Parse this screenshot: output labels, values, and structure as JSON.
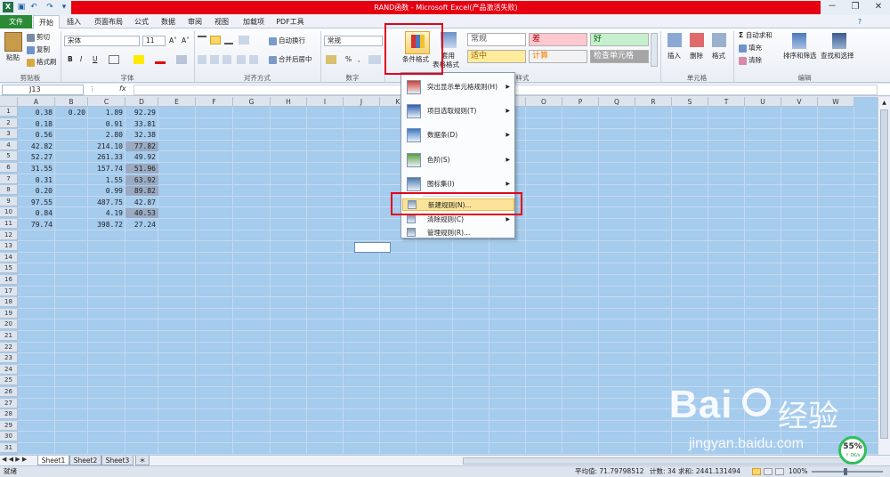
{
  "window": {
    "title": "RAND函数 - Microsoft Excel(产品激活失败)",
    "minimize": "－",
    "restore": "❐",
    "close": "✕"
  },
  "qat": {
    "save_glyph": "▣",
    "undo_glyph": "↶",
    "redo_glyph": "↷",
    "more_glyph": "▾"
  },
  "tabs": [
    "文件",
    "开始",
    "插入",
    "页面布局",
    "公式",
    "数据",
    "审阅",
    "视图",
    "加载项",
    "PDF工具"
  ],
  "ribbon": {
    "clipboard": {
      "paste": "粘贴",
      "cut": "剪切",
      "copy": "复制",
      "format_painter": "格式刷",
      "label": "剪贴板"
    },
    "font": {
      "font_name": "宋体",
      "font_size": "11",
      "grow": "A˄",
      "shrink": "A˅",
      "bold": "B",
      "italic": "I",
      "underline": "U",
      "label": "字体"
    },
    "alignment": {
      "wrap": "自动换行",
      "merge": "合并后居中",
      "label": "对齐方式"
    },
    "number": {
      "format": "常规",
      "percent": "%",
      "comma": ",",
      "label": "数字"
    },
    "styles": {
      "conditional": "条件格式",
      "table_format_line1": "套用",
      "table_format_line2": "表格格式",
      "cells": [
        {
          "text": "常规",
          "bg": "#ffffff",
          "color": "#555555"
        },
        {
          "text": "差",
          "bg": "#ffc7ce",
          "color": "#9c0006"
        },
        {
          "text": "好",
          "bg": "#c6efce",
          "color": "#006100"
        },
        {
          "text": "适中",
          "bg": "#ffeb9c",
          "color": "#9c6500"
        },
        {
          "text": "计算",
          "bg": "#f2f2f2",
          "color": "#fa7d00"
        },
        {
          "text": "检查单元格",
          "bg": "#a5a5a5",
          "color": "#ffffff"
        }
      ],
      "label": "样式"
    },
    "cells_group": {
      "insert": "插入",
      "delete": "删除",
      "format": "格式",
      "label": "单元格"
    },
    "editing": {
      "autosum": "自动求和",
      "fill": "填充",
      "clear": "清除",
      "sort_filter": "排序和筛选",
      "find_select": "查找和选择",
      "label": "编辑"
    }
  },
  "formula": {
    "name_box": "J13",
    "fx": "fx",
    "value": ""
  },
  "columns": [
    "A",
    "B",
    "C",
    "D",
    "E",
    "F",
    "G",
    "H",
    "I",
    "J",
    "K",
    "L",
    "M",
    "N",
    "O",
    "P",
    "Q",
    "R",
    "S",
    "T",
    "U",
    "V",
    "W"
  ],
  "rows": [
    "1",
    "2",
    "3",
    "4",
    "5",
    "6",
    "7",
    "8",
    "9",
    "10",
    "11",
    "12",
    "13",
    "14",
    "15",
    "16",
    "17",
    "18",
    "19",
    "20",
    "21",
    "22",
    "23",
    "24",
    "25",
    "26",
    "27",
    "28",
    "29",
    "30",
    "31"
  ],
  "data": [
    {
      "A": "0.38",
      "B": "0.20",
      "C": "1.89",
      "D": "92.29",
      "D_hl": false
    },
    {
      "A": "0.18",
      "B": "",
      "C": "0.91",
      "D": "33.81",
      "D_hl": false
    },
    {
      "A": "0.56",
      "B": "",
      "C": "2.80",
      "D": "32.38",
      "D_hl": false
    },
    {
      "A": "42.82",
      "B": "",
      "C": "214.10",
      "D": "77.82",
      "D_hl": true
    },
    {
      "A": "52.27",
      "B": "",
      "C": "261.33",
      "D": "49.92",
      "D_hl": false
    },
    {
      "A": "31.55",
      "B": "",
      "C": "157.74",
      "D": "51.96",
      "D_hl": true
    },
    {
      "A": "0.31",
      "B": "",
      "C": "1.55",
      "D": "63.92",
      "D_hl": true
    },
    {
      "A": "0.20",
      "B": "",
      "C": "0.99",
      "D": "89.82",
      "D_hl": true
    },
    {
      "A": "97.55",
      "B": "",
      "C": "487.75",
      "D": "42.87",
      "D_hl": false
    },
    {
      "A": "0.84",
      "B": "",
      "C": "4.19",
      "D": "40.53",
      "D_hl": true
    },
    {
      "A": "79.74",
      "B": "",
      "C": "398.72",
      "D": "27.24",
      "D_hl": false
    }
  ],
  "menu": [
    {
      "label": "突出显示单元格规则(H)",
      "arrow": "▶",
      "icon_color": "#d04030"
    },
    {
      "label": "项目选取规则(T)",
      "arrow": "▶",
      "icon_color": "#3060b0"
    },
    {
      "label": "数据条(D)",
      "arrow": "▶",
      "icon_color": "#3c78c8"
    },
    {
      "label": "色阶(S)",
      "arrow": "▶",
      "icon_color": "#5aa040"
    },
    {
      "label": "图标集(I)",
      "arrow": "▶",
      "icon_color": "#4a7ab0"
    },
    {
      "label": "新建规则(N)...",
      "arrow": "",
      "icon_color": "#8898b0"
    },
    {
      "label": "清除规则(C)",
      "arrow": "▶",
      "icon_color": "#8898b0"
    },
    {
      "label": "管理规则(R)...",
      "arrow": "",
      "icon_color": "#8898b0"
    }
  ],
  "sheets": [
    "Sheet1",
    "Sheet2",
    "Sheet3"
  ],
  "status": {
    "ready": "就绪",
    "average": "平均值: 71.79798512",
    "count": "计数: 34",
    "sum": "求和: 2441.131494",
    "zoom": "100%"
  },
  "overlay": {
    "progress": "55%",
    "progress_sub": "↑ 0K/s",
    "watermark_main": "Bai",
    "watermark_cn": "经验",
    "watermark_url": "jingyan.baidu.com"
  }
}
